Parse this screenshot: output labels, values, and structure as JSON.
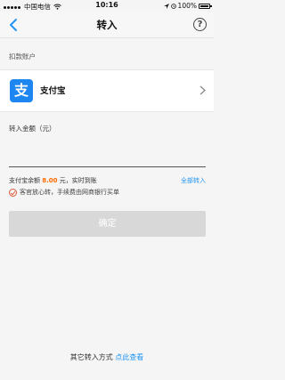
{
  "status_bar": {
    "carrier": "中国电信",
    "time": "10:16",
    "battery": "100%"
  },
  "nav": {
    "title": "转入",
    "help": "?"
  },
  "source_section": {
    "label": "扣款账户"
  },
  "account": {
    "logo_char": "支",
    "name": "支付宝"
  },
  "amount": {
    "label": "转入金额（元）",
    "value": "",
    "placeholder": ""
  },
  "balance": {
    "prefix": "支付宝余额 ",
    "amount": "8.00",
    "suffix": " 元，实时到账",
    "transfer_all": "全部转入"
  },
  "insurance": {
    "text": "客官放心转，手续费由网商银行买单"
  },
  "confirm_button": "确定",
  "footer": {
    "text": "其它转入方式",
    "link": "点此查看"
  },
  "colors": {
    "accent": "#2196f3",
    "alipay": "#1d86f0",
    "balance_amount": "#ff6a00",
    "disabled_button": "#d8d8d8"
  }
}
